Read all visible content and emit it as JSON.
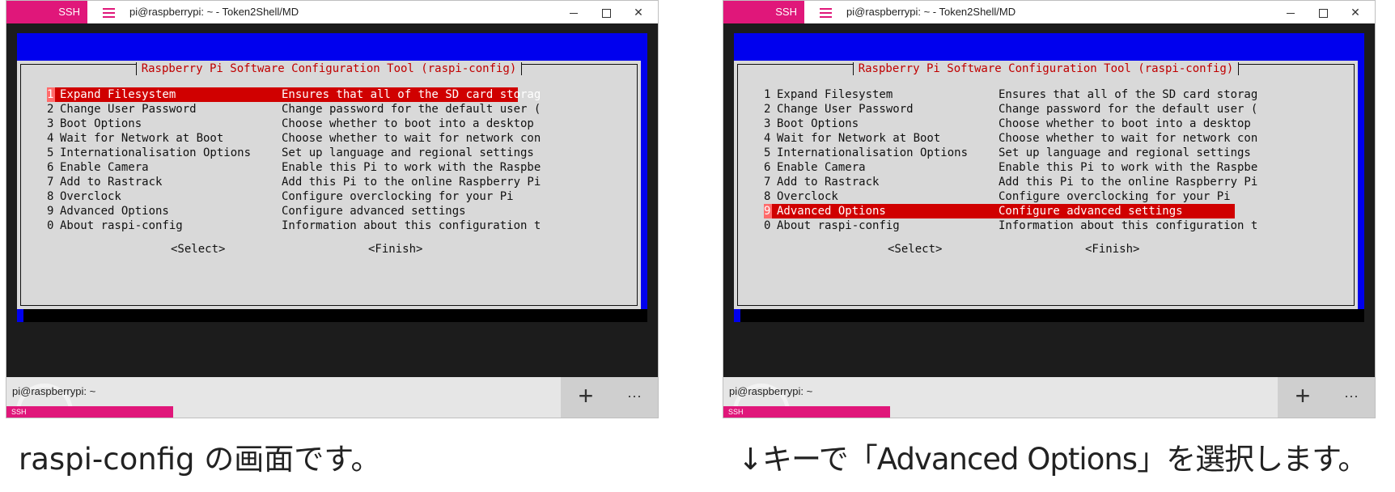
{
  "panels": [
    {
      "window": {
        "ssh_badge": "SSH",
        "title": "pi@raspberrypi: ~ - Token2Shell/MD",
        "menu_icon": "hamburger-icon",
        "controls": {
          "minimize_icon": "minimize-icon",
          "maximize_icon": "maximize-icon",
          "close_icon": "close-icon"
        }
      },
      "dialog": {
        "title": "Raspberry Pi Software Configuration Tool (raspi-config)",
        "selected_index": 0,
        "items": [
          {
            "num": "1",
            "label": "Expand Filesystem",
            "desc": "Ensures that all of the SD card storag"
          },
          {
            "num": "2",
            "label": "Change User Password",
            "desc": "Change password for the default user ("
          },
          {
            "num": "3",
            "label": "Boot Options",
            "desc": "Choose whether to boot into a desktop"
          },
          {
            "num": "4",
            "label": "Wait for Network at Boot",
            "desc": "Choose whether to wait for network con"
          },
          {
            "num": "5",
            "label": "Internationalisation Options",
            "desc": "Set up language and regional settings"
          },
          {
            "num": "6",
            "label": "Enable Camera",
            "desc": "Enable this Pi to work with the Raspbe"
          },
          {
            "num": "7",
            "label": "Add to Rastrack",
            "desc": "Add this Pi to the online Raspberry Pi"
          },
          {
            "num": "8",
            "label": "Overclock",
            "desc": "Configure overclocking for your Pi"
          },
          {
            "num": "9",
            "label": "Advanced Options",
            "desc": "Configure advanced settings"
          },
          {
            "num": "0",
            "label": "About raspi-config",
            "desc": "Information about this configuration t"
          }
        ],
        "select_button": "<Select>",
        "finish_button": "<Finish>"
      },
      "bottom_bar": {
        "tab_label": "pi@raspberrypi: ~",
        "tab_badge": "SSH",
        "add_tab": "+",
        "more": "···"
      },
      "caption": "raspi-config の画面です。"
    },
    {
      "window": {
        "ssh_badge": "SSH",
        "title": "pi@raspberrypi: ~ - Token2Shell/MD",
        "menu_icon": "hamburger-icon",
        "controls": {
          "minimize_icon": "minimize-icon",
          "maximize_icon": "maximize-icon",
          "close_icon": "close-icon"
        }
      },
      "dialog": {
        "title": "Raspberry Pi Software Configuration Tool (raspi-config)",
        "selected_index": 8,
        "items": [
          {
            "num": "1",
            "label": "Expand Filesystem",
            "desc": "Ensures that all of the SD card storag"
          },
          {
            "num": "2",
            "label": "Change User Password",
            "desc": "Change password for the default user ("
          },
          {
            "num": "3",
            "label": "Boot Options",
            "desc": "Choose whether to boot into a desktop"
          },
          {
            "num": "4",
            "label": "Wait for Network at Boot",
            "desc": "Choose whether to wait for network con"
          },
          {
            "num": "5",
            "label": "Internationalisation Options",
            "desc": "Set up language and regional settings"
          },
          {
            "num": "6",
            "label": "Enable Camera",
            "desc": "Enable this Pi to work with the Raspbe"
          },
          {
            "num": "7",
            "label": "Add to Rastrack",
            "desc": "Add this Pi to the online Raspberry Pi"
          },
          {
            "num": "8",
            "label": "Overclock",
            "desc": "Configure overclocking for your Pi"
          },
          {
            "num": "9",
            "label": "Advanced Options",
            "desc": "Configure advanced settings"
          },
          {
            "num": "0",
            "label": "About raspi-config",
            "desc": "Information about this configuration t"
          }
        ],
        "select_button": "<Select>",
        "finish_button": "<Finish>"
      },
      "bottom_bar": {
        "tab_label": "pi@raspberrypi: ~",
        "tab_badge": "SSH",
        "add_tab": "+",
        "more": "···"
      },
      "caption": "↓キーで「Advanced Options」を選択します。"
    }
  ],
  "colors": {
    "accent": "#e0177a",
    "terminal_blue": "#0000ee",
    "dialog_gray": "#d9d9d9",
    "selection_red": "#d00000",
    "title_red": "#c00000"
  }
}
